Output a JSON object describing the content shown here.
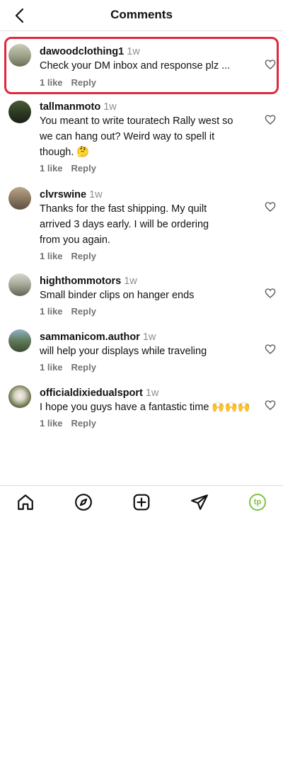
{
  "header": {
    "title": "Comments",
    "back_icon": "chevron-left-icon"
  },
  "comments": [
    {
      "username": "dawoodclothing1",
      "time": "1w",
      "text": "Check your DM inbox and response plz ...",
      "likes": "1 like",
      "reply": "Reply"
    },
    {
      "username": "tallmanmoto",
      "time": "1w",
      "text": "You meant to write touratech Rally west so we can hang out? Weird way to spell it though. 🤔",
      "likes": "1 like",
      "reply": "Reply"
    },
    {
      "username": "clvrswine",
      "time": "1w",
      "text": "Thanks for the fast shipping. My quilt arrived 3 days early. I will be ordering from you again.",
      "likes": "1 like",
      "reply": "Reply"
    },
    {
      "username": "highthommotors",
      "time": "1w",
      "text": "Small binder clips on hanger ends",
      "likes": "1 like",
      "reply": "Reply"
    },
    {
      "username": "sammanicom.author",
      "time": "1w",
      "text": "will help your displays while traveling",
      "likes": "1 like",
      "reply": "Reply"
    },
    {
      "username": "officialdixiedualsport",
      "time": "1w",
      "text": "I hope you guys have a fantastic time 🙌🙌🙌",
      "likes": "1 like",
      "reply": "Reply"
    }
  ],
  "bottom_nav": {
    "items": [
      "home-icon",
      "explore-compass-icon",
      "create-plus-icon",
      "direct-send-icon",
      "profile-avatar-icon"
    ],
    "profile_initials": "tp"
  },
  "colors": {
    "highlight": "#e0283a",
    "profile_accent": "#7cc242"
  }
}
